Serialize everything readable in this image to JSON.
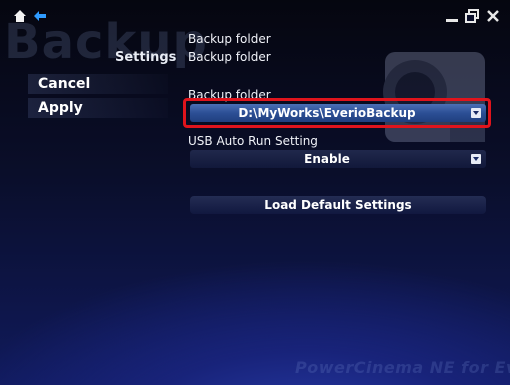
{
  "window": {
    "big_title": "Backup",
    "section_label": "Settings"
  },
  "top_bar": {
    "home_icon": "home-icon",
    "back_icon": "back-arrow-icon",
    "minimize_icon": "minimize-icon",
    "restore_icon": "restore-icon",
    "close_icon": "close-icon"
  },
  "sidebar": {
    "items": [
      {
        "label": "Cancel"
      },
      {
        "label": "Apply"
      }
    ]
  },
  "main": {
    "header_line1": "Backup folder",
    "header_line2": "Backup folder",
    "backup_folder_label": "Backup folder",
    "backup_folder_value": "D:\\MyWorks\\EverioBackup",
    "usb_label": "USB Auto Run Setting",
    "usb_value": "Enable",
    "load_default_label": "Load Default Settings"
  },
  "branding": {
    "text": "PowerCinema NE for Everio"
  },
  "colors": {
    "highlight_frame": "#e0141c",
    "selected_dropdown": "#2c4f95",
    "accent_icon": "#2f9bff"
  }
}
